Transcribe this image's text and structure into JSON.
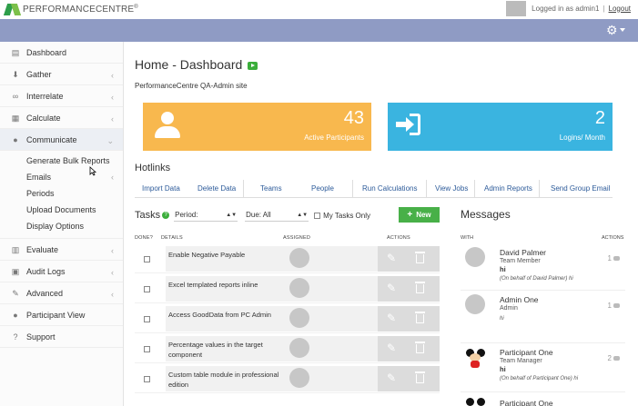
{
  "header": {
    "logo_text": "PERFORMANCECENTRE",
    "logo_suffix": "®",
    "logged_in": "Logged in as admin1",
    "separator": "|",
    "logout_label": "Logout"
  },
  "sidebar": {
    "items": [
      {
        "label": "Dashboard",
        "icon": "chart-icon"
      },
      {
        "label": "Gather",
        "icon": "download-icon"
      },
      {
        "label": "Interrelate",
        "icon": "link-icon"
      },
      {
        "label": "Calculate",
        "icon": "calculator-icon"
      },
      {
        "label": "Communicate",
        "icon": "comments-icon"
      }
    ],
    "sub_items": [
      "Generate Bulk Reports",
      "Emails",
      "Periods",
      "Upload Documents",
      "Display Options"
    ],
    "items_bottom": [
      {
        "label": "Evaluate",
        "icon": "bar-chart-icon"
      },
      {
        "label": "Audit Logs",
        "icon": "log-icon"
      },
      {
        "label": "Advanced",
        "icon": "wrench-icon"
      },
      {
        "label": "Participant View",
        "icon": "person-icon"
      },
      {
        "label": "Support",
        "icon": "help-icon"
      }
    ]
  },
  "main": {
    "title": "Home - Dashboard",
    "site_name": "PerformanceCentre QA-Admin site",
    "tiles": [
      {
        "value": "43",
        "label": "Active Participants",
        "color": "#f8b84e"
      },
      {
        "value": "2",
        "label": "Logins/ Month",
        "color": "#3ab4e0"
      }
    ],
    "hotlinks_title": "Hotlinks",
    "hotlinks": [
      "Import Data",
      "Delete Data",
      "Teams",
      "People",
      "Run Calculations",
      "View Jobs",
      "Admin Reports",
      "Send Group Email"
    ],
    "tasks": {
      "title": "Tasks",
      "period_label": "Period:",
      "due_label": "Due: All",
      "my_tasks_label": "My Tasks Only",
      "new_label": "New",
      "columns": {
        "done": "DONE?",
        "details": "DETAILS",
        "assigned": "ASSIGNED",
        "actions": "ACTIONS"
      },
      "rows": [
        "Enable Negative Payable",
        "Excel templated reports inline",
        "Access GoodData from PC Admin",
        "Percentage values in the target component",
        "Custom table module in professional edition"
      ]
    },
    "messages": {
      "title": "Messages",
      "columns": {
        "with": "WITH",
        "actions": "ACTIONS"
      },
      "items": [
        {
          "name": "David Palmer",
          "role": "Team Member",
          "text": "hi",
          "behalf": "(On behalf of David Palmer) hi",
          "count": "1"
        },
        {
          "name": "Admin One",
          "role": "Admin",
          "text": "hi",
          "behalf": "",
          "count": "1"
        },
        {
          "name": "Participant One",
          "role": "Team Manager",
          "text": "hi",
          "behalf": "(On behalf of Participant One) hi",
          "count": "2"
        },
        {
          "name": "Participant One",
          "role": "",
          "text": "",
          "behalf": "",
          "count": ""
        }
      ]
    }
  },
  "colors": {
    "navbar": "#8f9bc4",
    "new_button": "#48b048",
    "hotlink": "#2d5b9a"
  }
}
